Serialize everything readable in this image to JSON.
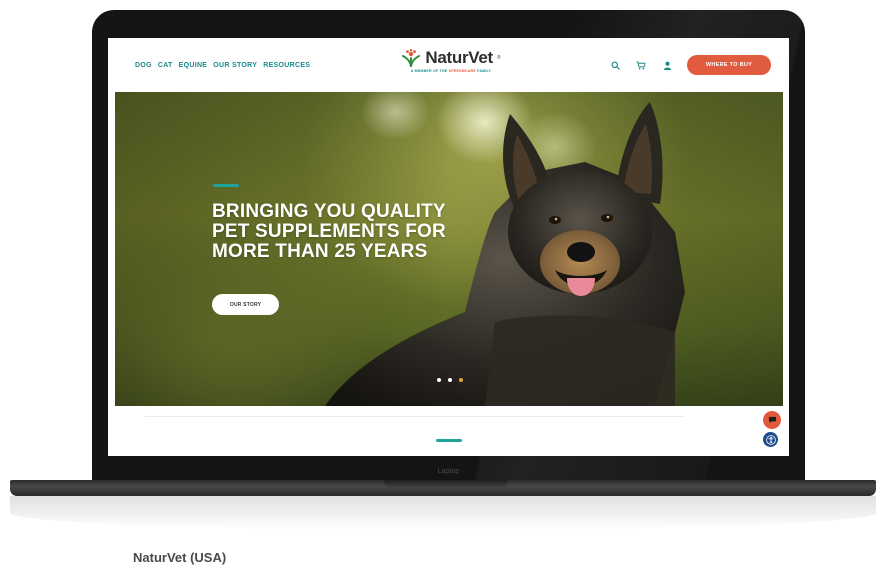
{
  "nav": {
    "items": [
      "DOG",
      "CAT",
      "EQUINE",
      "OUR STORY",
      "RESOURCES"
    ],
    "where_to_buy": "WHERE TO BUY",
    "icons": [
      "search-icon",
      "cart-icon",
      "user-icon"
    ]
  },
  "logo": {
    "name": "NaturVet",
    "reg": "®",
    "tagline_prefix": "A MEMBER OF THE ",
    "tagline_highlight": "SPEEDMCARE",
    "tagline_suffix": " FAMILY"
  },
  "hero": {
    "headline": "BRINGING YOU QUALITY\nPET SUPPLEMENTS FOR\nMORE THAN 25 YEARS",
    "button": "OUR STORY",
    "slides_total": 3,
    "active_slide": 3
  },
  "device_label": "Laptop",
  "caption": "NaturVet (USA)",
  "colors": {
    "teal": "#1b8a8a",
    "accent": "#e15c3e",
    "accessibility": "#1e4c8c"
  }
}
